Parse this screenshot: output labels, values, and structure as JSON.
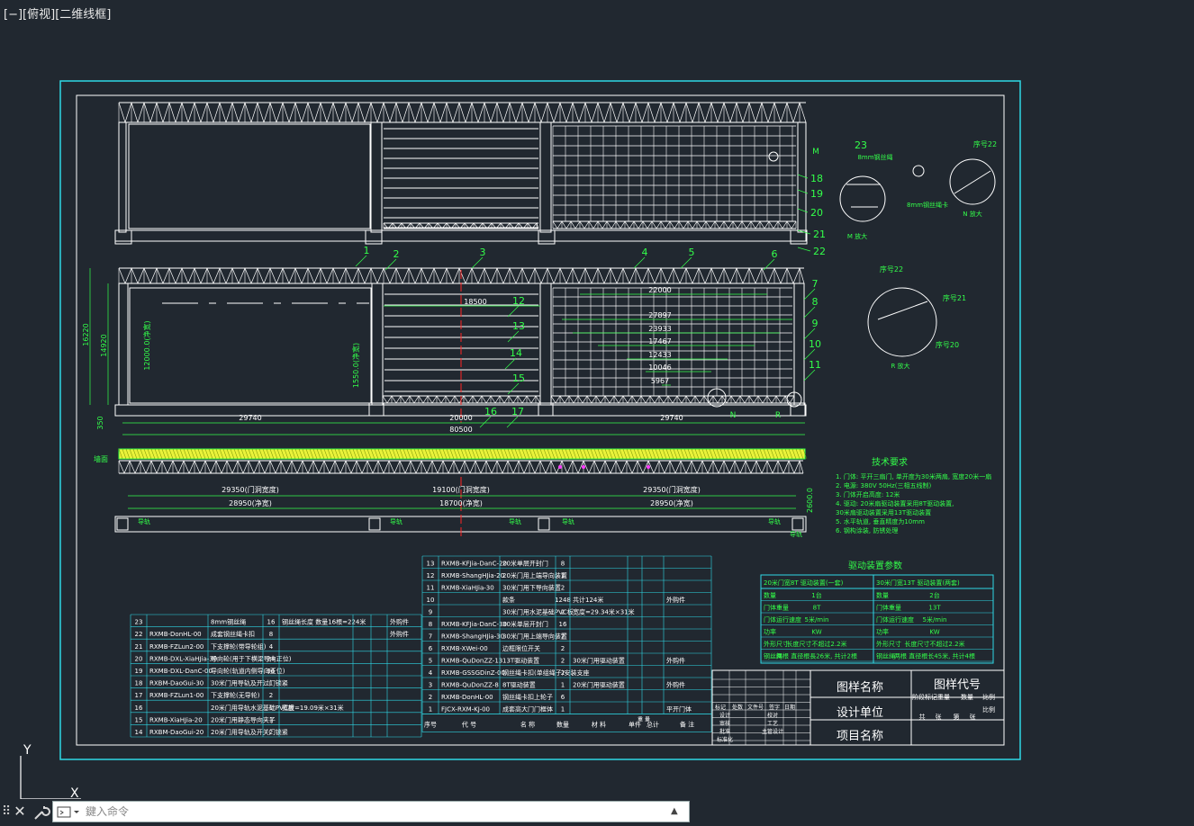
{
  "viewport": {
    "label_parts": [
      "[−]",
      "[俯视]",
      "[二维线框]"
    ],
    "axis_x": "X",
    "axis_y": "Y"
  },
  "colors": {
    "background": "#212830",
    "frame": "#2fd9e6",
    "white": "#ffffff",
    "green": "#33ff4a",
    "yellow": "#e9f23a",
    "red": "#ff2424",
    "magenta": "#ff3cff"
  },
  "command_line": {
    "placeholder": "鍵入命令",
    "close_icon": "close-icon",
    "settings_icon": "wrench-icon",
    "prompt_icon": "command-prompt-icon",
    "history_icon": "chevron-up-icon"
  },
  "callouts": {
    "plan": [
      "1",
      "2",
      "3",
      "4",
      "5",
      "6",
      "7",
      "8",
      "9",
      "10",
      "11",
      "12",
      "13",
      "14",
      "15",
      "16",
      "17"
    ],
    "top": [
      "18",
      "19",
      "20",
      "21",
      "22"
    ],
    "detail_M": [
      "23",
      "8mm钢丝绳",
      "8mm钢丝绳卡",
      "M 放大"
    ],
    "detail_N": [
      "序号22",
      "N 放大"
    ],
    "detail_R": [
      "序号22",
      "序号21",
      "序号20",
      "R 放大"
    ],
    "top_marker": "M",
    "plan_markers": [
      "N",
      "R"
    ]
  },
  "dimensions": {
    "plan_inner": [
      "22000",
      "18500",
      "27897",
      "23933",
      "17467",
      "12433",
      "10046",
      "5967"
    ],
    "plan_bottom": [
      "29740",
      "20000",
      "29740",
      "80500"
    ],
    "plan_left": [
      "16220",
      "14920",
      "350",
      "12000.0(净宽)",
      "1550.0(净宽)"
    ],
    "elev_top": [
      "29350(门洞宽度)",
      "19100(门洞宽度)",
      "29350(门洞宽度)"
    ],
    "elev_mid": [
      "28950(净宽)",
      "18700(净宽)",
      "28950(净宽)"
    ],
    "elev_right": "2600.0",
    "elev_label_left": "墙面",
    "rail_labels": [
      "导轨",
      "导轨",
      "导轨",
      "导轨",
      "导轨",
      "导轨"
    ]
  },
  "tech_notes": {
    "title": "技术要求",
    "items": [
      "1. 门体: 平开三扇门, 单开度为30米两扇, 宽度20米一扇",
      "2. 电源: 380V 50Hz(三相五线制)",
      "3. 门体开启高度: 12米",
      "4. 驱动: 20米扇驱动装置采用8T驱动装置,",
      "   30米扇驱动装置采用13T驱动装置",
      "5. 水平轨道, 垂直精度为10mm",
      "6. 钢构涂装, 防锈处理"
    ]
  },
  "drive_table": {
    "title": "驱动装置参数",
    "header": [
      "20米门宽8T 驱动装置(一套)",
      "30米门宽13T 驱动装置(两套)"
    ],
    "rows": [
      [
        "数量",
        "1台",
        "数量",
        "2台"
      ],
      [
        "门体重量",
        "8T",
        "门体重量",
        "13T"
      ],
      [
        "门体运行速度",
        "5米/min",
        "门体运行速度",
        "5米/min"
      ],
      [
        "功率",
        "KW",
        "功率",
        "KW"
      ],
      [
        "外形尺寸",
        "长度尺寸不超过2.2米",
        "外形尺寸",
        "长度尺寸不超过2.2米"
      ],
      [
        "钢丝绳",
        "两根 直径根長26米, 共计2根",
        "钢丝绳",
        "两根 直径根长45米, 共计4根"
      ]
    ]
  },
  "bom_left": {
    "rows": [
      [
        "23",
        "",
        "8mm钢丝绳",
        "16",
        "钢丝绳长度 数量16根=224米",
        "",
        "",
        "外购件"
      ],
      [
        "22",
        "RXMB-DonHL-00",
        "成套钢丝绳卡扣",
        "8",
        "",
        "",
        "",
        "外购件"
      ],
      [
        "21",
        "RXMB-FZLun2-00",
        "下支撑轮(带导轮组)",
        "4",
        "",
        "",
        "",
        ""
      ],
      [
        "20",
        "RXMB-DXL-XiaHJia-30",
        "导向轮(用于下横梁导向正位)",
        "24",
        "",
        "",
        "",
        ""
      ],
      [
        "19",
        "RXMB-DXL-DanC-00",
        "导向轮(轨道内侧导向正位)",
        "96",
        "",
        "",
        "",
        ""
      ],
      [
        "18",
        "RXBM-DaoGui-30",
        "30米门用导轨及开过门锁紧",
        "1",
        "",
        "",
        "",
        ""
      ],
      [
        "17",
        "RXMB-FZLun1-00",
        "下支撑轮(无导轮)",
        "2",
        "",
        "",
        "",
        ""
      ],
      [
        "16",
        "",
        "20米门用导轨水泥基础PVC板",
        "1",
        "宽度=19.09米×31米",
        "",
        "",
        ""
      ],
      [
        "15",
        "RXMB-XiaHJia-20",
        "20米门用静态导向夹子",
        "1",
        "",
        "",
        "",
        ""
      ],
      [
        "14",
        "RXBM-DaoGui-20",
        "20米门用导轨及开关门锁紧",
        "2",
        "",
        "",
        "",
        ""
      ]
    ]
  },
  "bom_mid": {
    "rows": [
      [
        "13",
        "RXMB-KFJia-DanC-20",
        "20米单层开封门",
        "8",
        "",
        "",
        "",
        ""
      ],
      [
        "12",
        "RXMB-ShangHJia-20",
        "20米门用上端导向装置",
        "1",
        "",
        "",
        "",
        ""
      ],
      [
        "11",
        "RXMB-XiaHJia-30",
        "30米门用下导向装置",
        "2",
        "",
        "",
        "",
        ""
      ],
      [
        "10",
        "",
        "款条",
        "1248",
        "共计124米",
        "",
        "",
        "外购件"
      ],
      [
        "9",
        "",
        "30米门用水泥基础PVC板",
        "2",
        "宽度=29.34米×31米",
        "",
        "",
        ""
      ],
      [
        "8",
        "RXMB-KFJia-DanC-30",
        "30米单层开封门",
        "16",
        "",
        "",
        "",
        ""
      ],
      [
        "7",
        "RXMB-ShangHJia-30",
        "30米门用上端导向装置",
        "2",
        "",
        "",
        "",
        ""
      ],
      [
        "6",
        "RXMB-XWei-00",
        "边框限位开关",
        "2",
        "",
        "",
        "",
        ""
      ],
      [
        "5",
        "RXMB-QuDonZZ-13",
        "13T驱动装置",
        "2",
        "30米门用驱动装置",
        "",
        "",
        "外购件"
      ],
      [
        "4",
        "RXMB-GSSGDinZ-00",
        "钢丝绳卡扣(单组绳子)安装支座",
        "2",
        "",
        "",
        "",
        ""
      ],
      [
        "3",
        "RXMB-QuDonZZ-8",
        "8T驱动装置",
        "1",
        "20米门用驱动装置",
        "",
        "",
        "外购件"
      ],
      [
        "2",
        "RXMB-DonHL-00",
        "钢丝绳卡扣上轮子",
        "6",
        "",
        "",
        "",
        ""
      ],
      [
        "1",
        "FJCX-RXM-KJ-00",
        "成套高大门门框体",
        "1",
        "",
        "",
        "",
        "平开门体"
      ]
    ],
    "header": [
      "序号",
      "代  号",
      "名  称",
      "数量",
      "材  料",
      "单件",
      "总计",
      "备  注"
    ],
    "header_sub": [
      "重  量"
    ]
  },
  "title_block": {
    "drawing_name": "图样名称",
    "drawing_code": "图样代号",
    "designer": "设计单位",
    "project_name": "项目名称",
    "right_labels": [
      "阶段标记",
      "重量",
      "数量",
      "比例",
      "共",
      "张",
      "第",
      "张",
      "比例"
    ],
    "left_labels": [
      "标记",
      "处数",
      "文件号",
      "签字",
      "日期",
      "设计",
      "校对",
      "审核",
      "工艺",
      "批准",
      "主管设计",
      "标准化"
    ]
  }
}
